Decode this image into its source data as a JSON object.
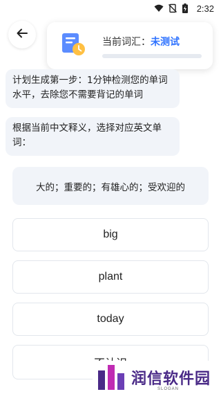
{
  "status_bar": {
    "time": "2:32",
    "icons": [
      "wifi-icon",
      "no-sim-icon",
      "battery-charging-icon"
    ]
  },
  "header": {
    "back_icon": "arrow-left-icon",
    "current_word_label": "当前词汇：",
    "current_word_value": "未测试",
    "progress": 0,
    "accent_color": "#2f73ff"
  },
  "chat": {
    "messages": [
      "计划生成第一步：1分钟检测您的单词水平，去除您不需要背记的单词",
      "根据当前中文释义，选择对应英文单词："
    ]
  },
  "question": {
    "meaning": "大的；重要的；有雄心的；受欢迎的"
  },
  "options": [
    "big",
    "plant",
    "today",
    "不认识"
  ],
  "watermark": {
    "text": "润信软件园",
    "slogan": "SLOGAN"
  }
}
